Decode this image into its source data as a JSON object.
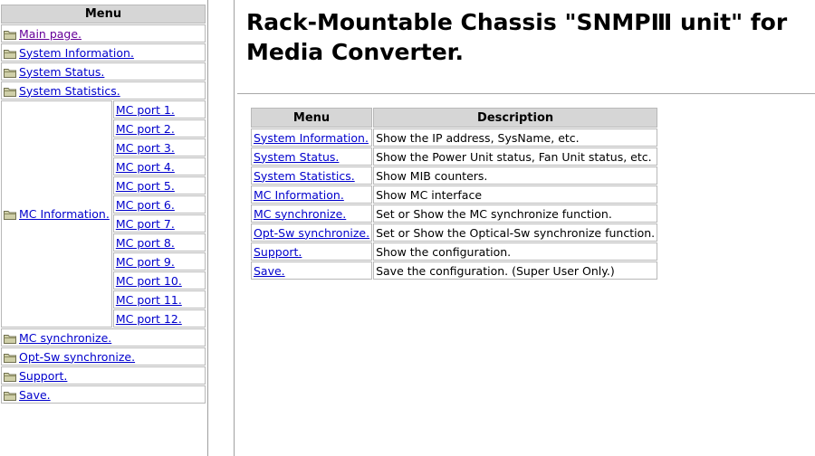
{
  "menu": {
    "header": "Menu",
    "items_top": [
      {
        "label": "Main page.",
        "visited": true
      },
      {
        "label": "System Information.",
        "visited": false
      },
      {
        "label": "System Status.",
        "visited": false
      },
      {
        "label": "System Statistics.",
        "visited": false
      }
    ],
    "mc_information": "MC Information.",
    "mc_ports": [
      "MC port 1.",
      "MC port 2.",
      "MC port 3.",
      "MC port 4.",
      "MC port 5.",
      "MC port 6.",
      "MC port 7.",
      "MC port 8.",
      "MC port 9.",
      "MC port 10.",
      "MC port 11.",
      "MC port 12."
    ],
    "items_bottom": [
      {
        "label": "MC synchronize."
      },
      {
        "label": "Opt-Sw synchronize."
      },
      {
        "label": "Support."
      },
      {
        "label": "Save."
      }
    ],
    "icon": "folder-icon"
  },
  "page": {
    "title": "Rack-Mountable Chassis \"SNMPⅢ unit\" for Media Converter."
  },
  "table": {
    "headers": [
      "Menu",
      "Description"
    ],
    "rows": [
      {
        "menu": "System Information.",
        "description": "Show the IP address, SysName, etc."
      },
      {
        "menu": "System Status.",
        "description": "Show the Power Unit status, Fan Unit status, etc."
      },
      {
        "menu": "System Statistics.",
        "description": "Show MIB counters."
      },
      {
        "menu": "MC Information.",
        "description": "Show MC interface"
      },
      {
        "menu": "MC synchronize.",
        "description": "Set or Show the MC synchronize function."
      },
      {
        "menu": "Opt-Sw synchronize.",
        "description": "Set or Show the Optical-Sw synchronize function."
      },
      {
        "menu": "Support.",
        "description": "Show the configuration."
      },
      {
        "menu": "Save.",
        "description": "Save the configuration. (Super User Only.)"
      }
    ]
  },
  "colors": {
    "link": "#0000cc",
    "visited": "#660099",
    "header_bg": "#d6d6d6",
    "folder": "#c8c8a0"
  }
}
